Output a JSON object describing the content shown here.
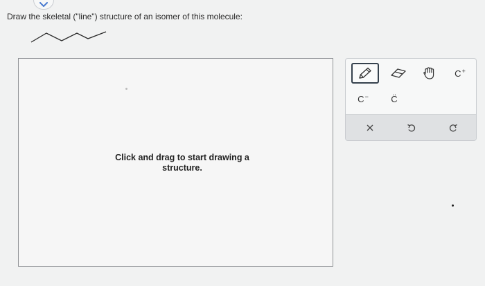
{
  "question": {
    "text": "Draw the skeletal (\"line\") structure of an isomer of this molecule:"
  },
  "canvas": {
    "hint": "Click and drag to start drawing a structure."
  },
  "toolbar": {
    "cation_label": "C",
    "cation_charge": "+",
    "anion_label": "C",
    "anion_charge": "−",
    "radical_label": "C̈",
    "icons": {
      "pencil": "pencil-icon",
      "eraser": "eraser-icon",
      "pan": "hand-icon",
      "clear": "close-icon",
      "undo": "undo-icon",
      "redo": "redo-icon"
    }
  },
  "colors": {
    "background": "#f1f2f2",
    "canvas_border": "#8e9195",
    "active_tool_border": "#35414d",
    "chevron": "#4a7bd0"
  }
}
